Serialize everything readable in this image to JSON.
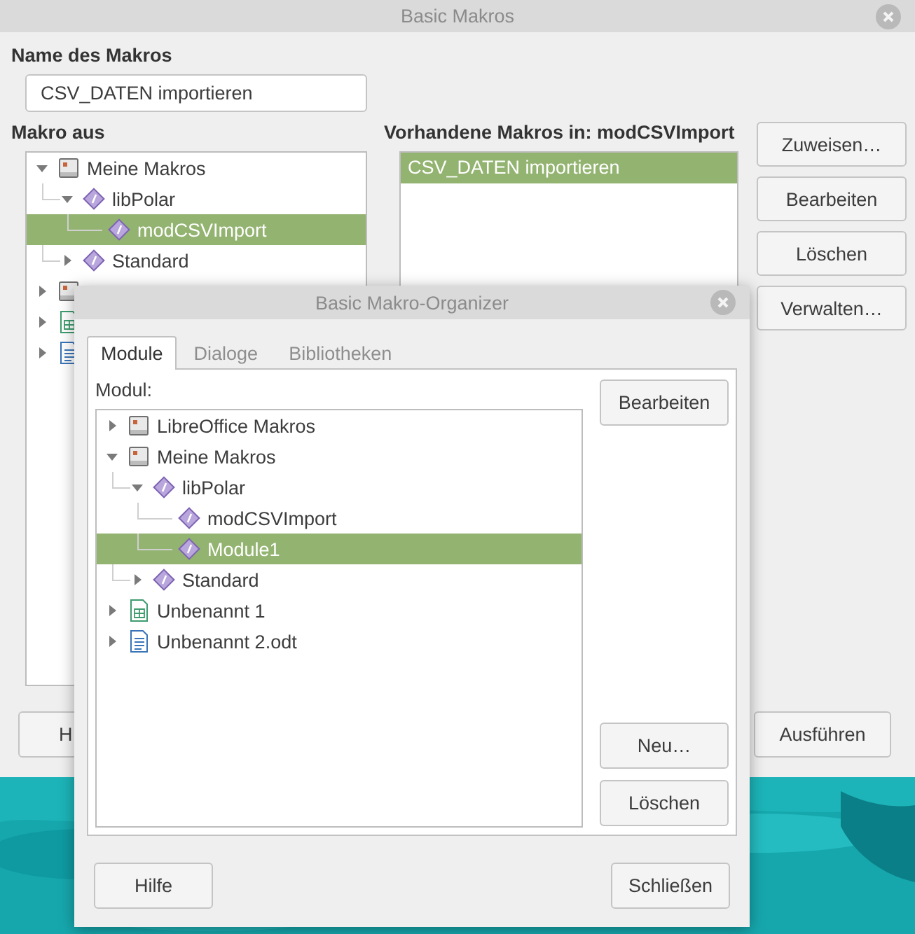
{
  "main_window": {
    "title": "Basic Makros",
    "name_label": "Name des Makros",
    "name_value": "CSV_DATEN importieren",
    "tree_label": "Makro aus",
    "tree": [
      {
        "kind": "container",
        "label": "Meine Makros",
        "expanded": true,
        "selected": false,
        "children": [
          {
            "kind": "library",
            "label": "libPolar",
            "expanded": true,
            "selected": false,
            "children": [
              {
                "kind": "module",
                "label": "modCSVImport",
                "selected": true
              }
            ]
          },
          {
            "kind": "library",
            "label": "Standard",
            "expanded": false,
            "selected": false
          }
        ]
      },
      {
        "kind": "container",
        "expanded": false
      },
      {
        "kind": "sheet",
        "expanded": false
      },
      {
        "kind": "document",
        "expanded": false
      }
    ],
    "list_label": "Vorhandene Makros in: modCSVImport",
    "macros": [
      {
        "label": "CSV_DATEN importieren",
        "selected": true
      }
    ],
    "side_buttons": [
      "Zuweisen…",
      "Bearbeiten",
      "Löschen",
      "Verwalten…"
    ],
    "help_button": "H",
    "run_button": "Ausführen"
  },
  "organizer": {
    "title": "Basic Makro-Organizer",
    "tabs": [
      {
        "label": "Module",
        "selected": true
      },
      {
        "label": "Dialoge",
        "selected": false
      },
      {
        "label": "Bibliotheken",
        "selected": false
      }
    ],
    "tree_label": "Modul:",
    "tree": [
      {
        "kind": "container",
        "label": "LibreOffice Makros",
        "expanded": false,
        "selected": false
      },
      {
        "kind": "container",
        "label": "Meine Makros",
        "expanded": true,
        "selected": false,
        "children": [
          {
            "kind": "library",
            "label": "libPolar",
            "expanded": true,
            "selected": false,
            "children": [
              {
                "kind": "module",
                "label": "modCSVImport",
                "selected": false
              },
              {
                "kind": "module",
                "label": "Module1",
                "selected": true
              }
            ]
          },
          {
            "kind": "library",
            "label": "Standard",
            "expanded": false,
            "selected": false
          }
        ]
      },
      {
        "kind": "sheet",
        "label": "Unbenannt 1",
        "expanded": false,
        "selected": false
      },
      {
        "kind": "document",
        "label": "Unbenannt 2.odt",
        "expanded": false,
        "selected": false
      }
    ],
    "edit_button": "Bearbeiten",
    "lower_buttons": [
      "Neu…",
      "Löschen"
    ],
    "help_button": "Hilfe",
    "close_button": "Schließen"
  }
}
